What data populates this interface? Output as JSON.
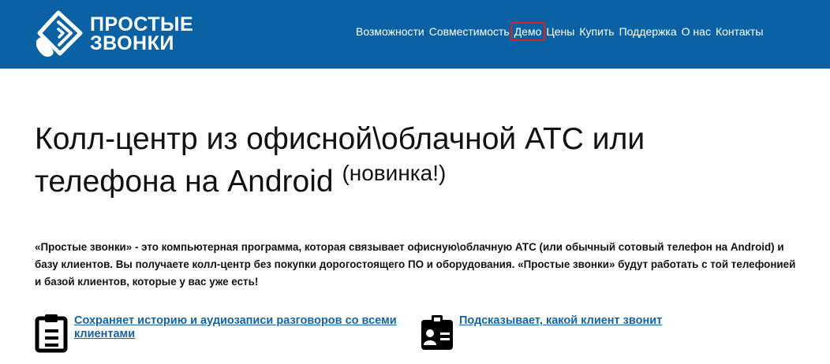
{
  "header": {
    "logo": {
      "line1": "ПРОСТЫЕ",
      "line2": "ЗВОНКИ"
    },
    "nav": [
      {
        "label": "Возможности"
      },
      {
        "label": "Совместимость"
      },
      {
        "label": "Демо",
        "highlighted": true
      },
      {
        "label": "Цены"
      },
      {
        "label": "Купить"
      },
      {
        "label": "Поддержка"
      },
      {
        "label": "О нас"
      },
      {
        "label": "Контакты"
      }
    ],
    "colors": {
      "background": "#0a62a4",
      "text": "#ffffff",
      "highlight_outline": "#e02020"
    }
  },
  "hero": {
    "title_line1": "Колл-центр из офисной\\облачной АТС или",
    "title_line2": "телефона на Android",
    "badge": "(новинка!)"
  },
  "intro": {
    "text": "«Простые звонки» - это компьютерная программа, которая связывает офисную\\облачную АТС (или обычный сотовый телефон на Android) и базу клиентов. Вы получаете колл-центр без покупки дорогостоящего ПО и оборудования. «Простые звонки» будут работать с той телефонией и базой клиентов, которые у вас уже есть!"
  },
  "features": [
    {
      "icon": "clipboard-icon",
      "text": "Сохраняет историю и аудиозаписи разговоров со всеми клиентами"
    },
    {
      "icon": "id-card-icon",
      "text": "Подсказывает, какой клиент звонит"
    }
  ],
  "colors": {
    "link": "#1463a5"
  }
}
